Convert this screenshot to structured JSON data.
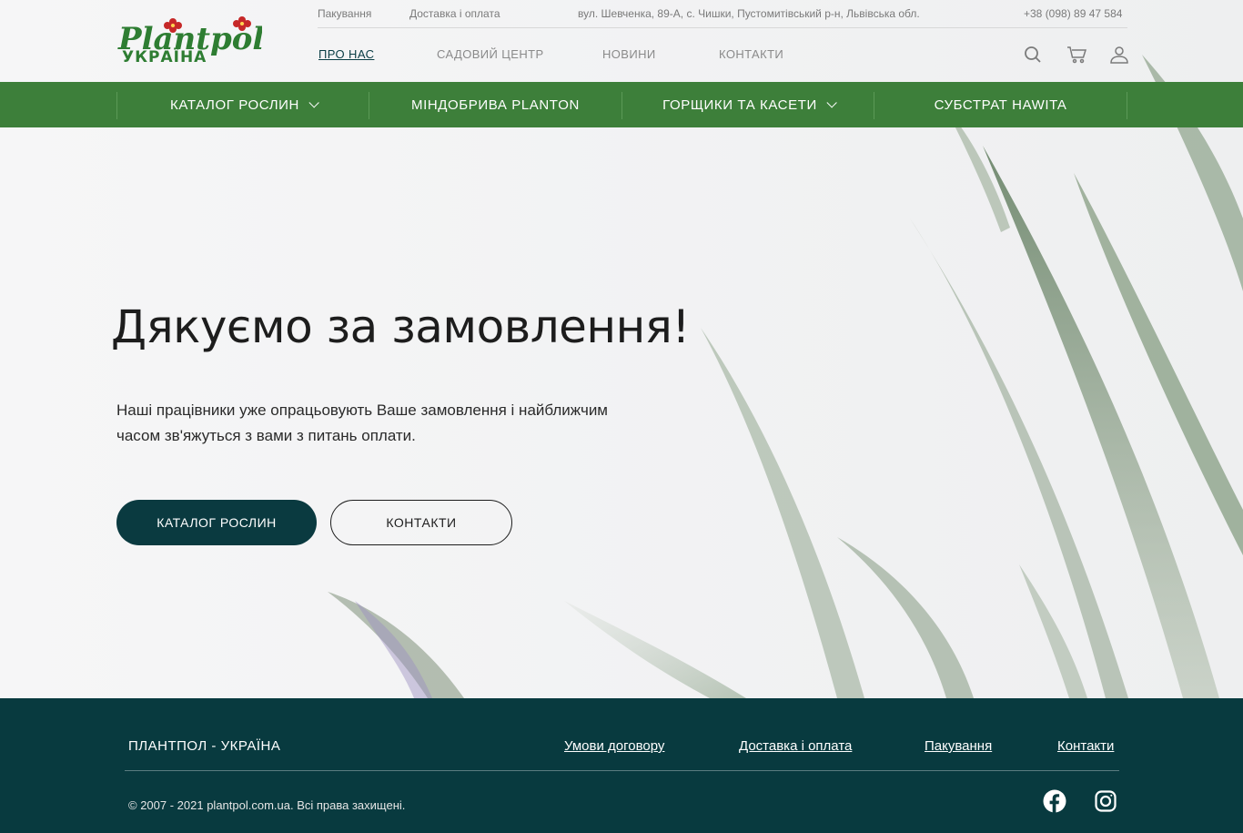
{
  "logo": {
    "text_top": "Plantpol",
    "text_bottom": "УКРАЇНА"
  },
  "topbar": {
    "packaging": "Пакування",
    "delivery": "Доставка і оплата",
    "address": "вул. Шевченка, 89-А, с. Чишки, Пустомитівський р-н, Львівська обл.",
    "phone": "+38 (098) 89 47 584"
  },
  "nav": {
    "about": "ПРО НАС",
    "garden": "САДОВИЙ ЦЕНТР",
    "news": "НОВИНИ",
    "contacts": "КОНТАКТИ"
  },
  "icons": {
    "search": "search-icon",
    "cart": "cart-icon",
    "user": "user-icon"
  },
  "catbar": {
    "plants": "КАТАЛОГ РОСЛИН",
    "fertilizers": "МІНДОБРИВА PLANTON",
    "pots": "ГОРЩИКИ ТА КАСЕТИ",
    "substrate": "СУБСТРАТ HAWITA"
  },
  "hero": {
    "title": "Дякуємо за замовлення!",
    "text": "Наші працівники уже опрацьовують Ваше замовлення і найближчим часом зв'яжуться з вами з питань оплати.",
    "btn_catalog": "КАТАЛОГ РОСЛИН",
    "btn_contacts": "КОНТАКТИ"
  },
  "footer": {
    "brand": "ПЛАНТПОЛ - УКРАЇНА",
    "terms": "Умови договору",
    "delivery": "Доставка і оплата",
    "packaging": "Пакування",
    "contacts": "Контакти",
    "copyright": "© 2007 - 2021 plantpol.com.ua. Всі права захищені."
  },
  "colors": {
    "green_bar": "#3d7f3a",
    "dark_teal": "#083a3f",
    "logo_green": "#2e7d32",
    "logo_red": "#c62828"
  }
}
